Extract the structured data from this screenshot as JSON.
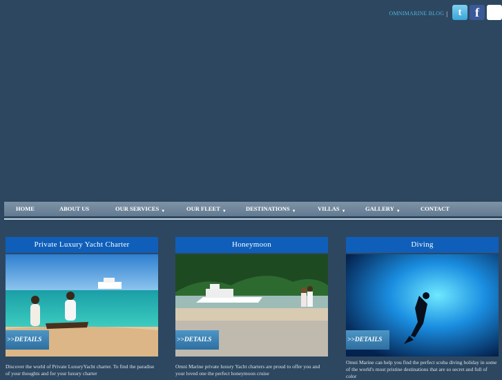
{
  "header": {
    "blog_link": "OMNIMARINE BLOG",
    "separator": "|",
    "social": [
      "twitter-icon",
      "facebook-icon",
      "qr-code-icon"
    ]
  },
  "nav": {
    "items": [
      {
        "label": "HOME",
        "dropdown": false
      },
      {
        "label": "ABOUT US",
        "dropdown": false
      },
      {
        "label": "OUR SERVICES",
        "dropdown": true
      },
      {
        "label": "OUR FLEET",
        "dropdown": true
      },
      {
        "label": "DESTINATIONS",
        "dropdown": true
      },
      {
        "label": "VILLAS",
        "dropdown": true
      },
      {
        "label": "GALLERY",
        "dropdown": true
      },
      {
        "label": "CONTACT",
        "dropdown": false
      }
    ]
  },
  "cards": [
    {
      "title": "Private Luxury Yacht Charter",
      "details": ">>DETAILS",
      "text": "Discover the world of Private LuxuryYacht charter. To find the paradise of your thoughts and for your luxury charter"
    },
    {
      "title": "Honeymoon",
      "details": ">>DETAILS",
      "text": "Omni Marine private luxury Yacht charters are proud to offer you and your loved one the perfect honeymoon cruise"
    },
    {
      "title": "Diving",
      "details": ">>DETAILS",
      "text": "Omni Marine can help you find the perfect scuba diving holiday in some of the world's most pristine destinations that are so secret and full of color"
    }
  ],
  "colors": {
    "background": "#2d4760",
    "card_title": "#0f5fba",
    "blog_link": "#4fb3dc"
  }
}
